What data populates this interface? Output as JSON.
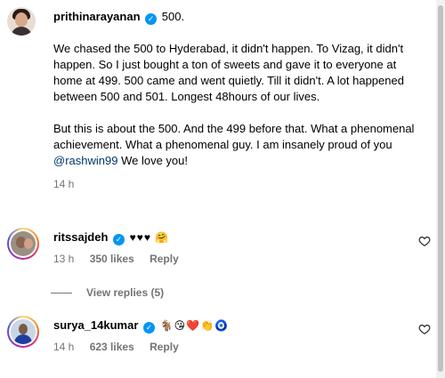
{
  "caption": {
    "username": "prithinarayanan",
    "title_text": "500.",
    "paragraph1": "We chased the 500 to Hyderabad, it didn't happen. To Vizag, it didn't happen. So I just bought a ton of sweets and gave it to everyone at home at 499. 500 came and went quietly. Till it didn't. A lot happened between 500 and 501. Longest 48hours of our lives.",
    "paragraph2": "But this is about the 500. And the 499 before that. What a phenomenal achievement. What a phenomenal guy. I am insanely proud of you",
    "mention": "@rashwin99",
    "paragraph2_end": "We love you!",
    "time": "14 h"
  },
  "comments": [
    {
      "username": "ritssajdeh",
      "text": "♥♥♥ 🤗",
      "time": "13 h",
      "likes": "350 likes",
      "reply": "Reply"
    },
    {
      "username": "surya_14kumar",
      "text": "🐐😘❤️👏🧿",
      "time": "14 h",
      "likes": "623 likes",
      "reply": "Reply"
    }
  ],
  "view_replies": "View replies (5)",
  "icons": {
    "verified": "verified-badge-icon",
    "like": "heart-outline-icon"
  },
  "colors": {
    "verified": "#0095f6",
    "mention": "#00376b",
    "secondary_text": "#737373"
  }
}
